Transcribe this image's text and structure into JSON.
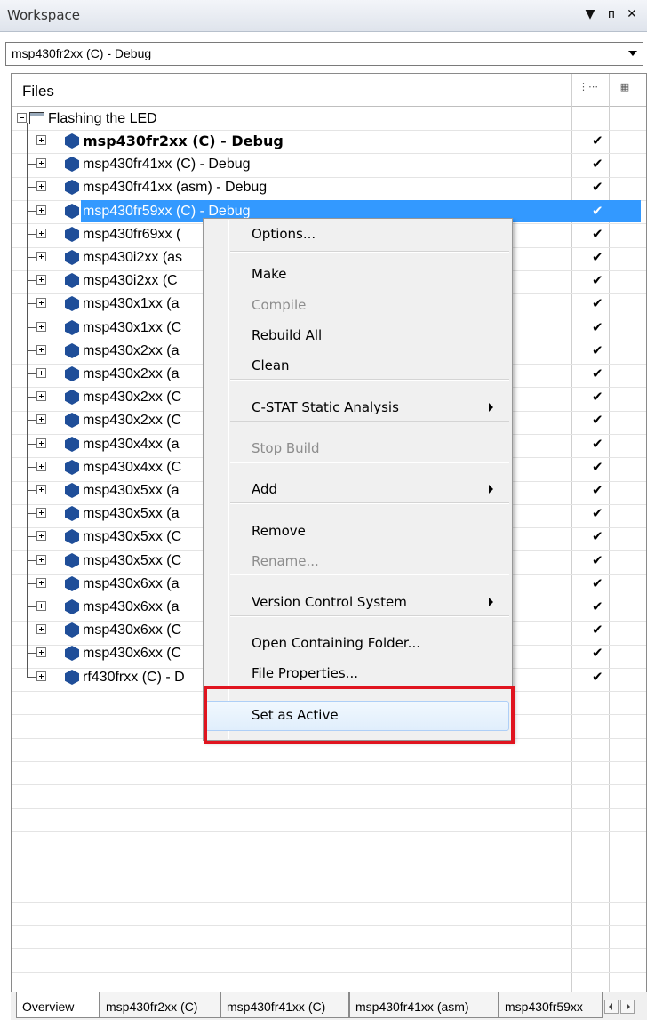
{
  "window": {
    "title": "Workspace",
    "dropdown_glyph": "▼",
    "pin_glyph": "ᴨ",
    "close_glyph": "✕"
  },
  "config_combo": {
    "value": "msp430fr2xx (C) - Debug"
  },
  "files": {
    "header": "Files",
    "root": "Flashing the LED",
    "projects": [
      {
        "name": "msp430fr2xx (C) - Debug",
        "bold": true,
        "checked": true
      },
      {
        "name": "msp430fr41xx (C) - Debug",
        "checked": true
      },
      {
        "name": "msp430fr41xx (asm) - Debug",
        "checked": true
      },
      {
        "name": "msp430fr59xx (C) - Debug",
        "selected": true,
        "checked": true
      },
      {
        "name": "msp430fr69xx (",
        "checked": true
      },
      {
        "name": "msp430i2xx (as",
        "checked": true
      },
      {
        "name": "msp430i2xx (C",
        "checked": true
      },
      {
        "name": "msp430x1xx (a",
        "checked": true
      },
      {
        "name": "msp430x1xx (C",
        "checked": true
      },
      {
        "name": "msp430x2xx (a",
        "checked": true
      },
      {
        "name": "msp430x2xx (a",
        "checked": true
      },
      {
        "name": "msp430x2xx (C",
        "checked": true
      },
      {
        "name": "msp430x2xx (C",
        "checked": true
      },
      {
        "name": "msp430x4xx (a",
        "checked": true
      },
      {
        "name": "msp430x4xx (C",
        "checked": true
      },
      {
        "name": "msp430x5xx (a",
        "checked": true
      },
      {
        "name": "msp430x5xx (a",
        "checked": true
      },
      {
        "name": "msp430x5xx (C",
        "checked": true
      },
      {
        "name": "msp430x5xx (C",
        "checked": true
      },
      {
        "name": "msp430x6xx (a",
        "checked": true
      },
      {
        "name": "msp430x6xx (a",
        "checked": true
      },
      {
        "name": "msp430x6xx (C",
        "checked": true
      },
      {
        "name": "msp430x6xx (C",
        "checked": true
      },
      {
        "name": "rf430frxx (C) - D",
        "checked": true
      }
    ],
    "check_glyph": "✔"
  },
  "context_menu": {
    "items": [
      {
        "label": "Options...",
        "enabled": true
      },
      {
        "label": "Make",
        "enabled": true
      },
      {
        "label": "Compile",
        "enabled": false
      },
      {
        "label": "Rebuild All",
        "enabled": true
      },
      {
        "label": "Clean",
        "enabled": true
      },
      {
        "label": "C-STAT Static Analysis",
        "enabled": true,
        "submenu": true
      },
      {
        "label": "Stop Build",
        "enabled": false
      },
      {
        "label": "Add",
        "enabled": true,
        "submenu": true
      },
      {
        "label": "Remove",
        "enabled": true
      },
      {
        "label": "Rename...",
        "enabled": false
      },
      {
        "label": "Version Control System",
        "enabled": true,
        "submenu": true
      },
      {
        "label": "Open Containing Folder...",
        "enabled": true
      },
      {
        "label": "File Properties...",
        "enabled": true
      },
      {
        "label": "Set as Active",
        "enabled": true,
        "hover": true
      }
    ],
    "highlight_color": "#e0141f"
  },
  "tabs": [
    {
      "label": "Overview",
      "active": true
    },
    {
      "label": "msp430fr2xx (C)"
    },
    {
      "label": "msp430fr41xx (C)"
    },
    {
      "label": "msp430fr41xx (asm)"
    },
    {
      "label": "msp430fr59xx"
    }
  ],
  "colors": {
    "selection": "#3399ff",
    "project_icon": "#1f4e99"
  }
}
